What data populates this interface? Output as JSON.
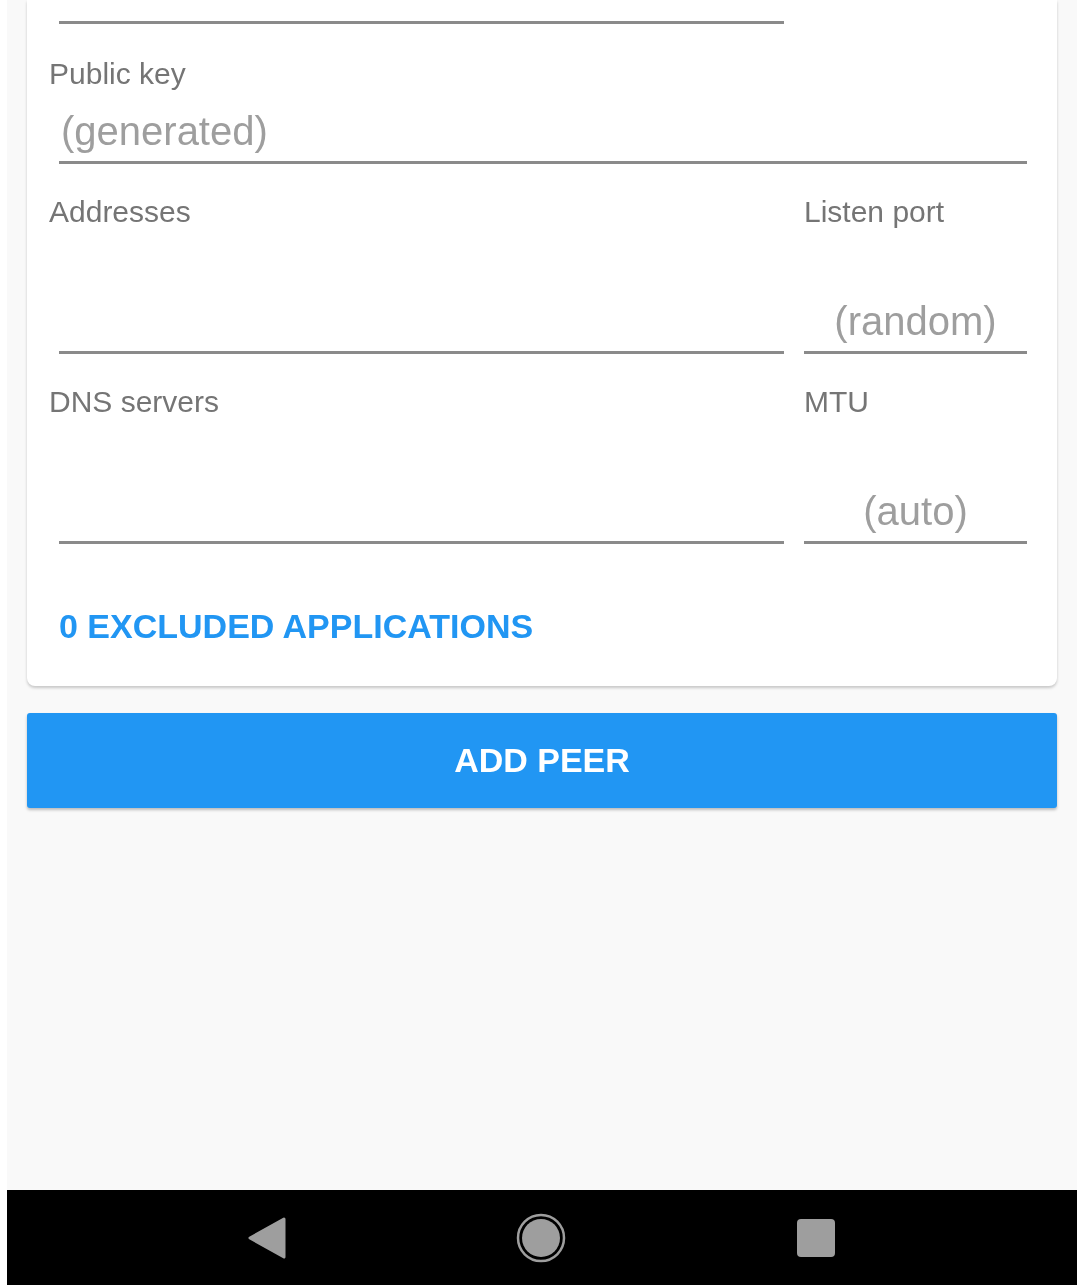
{
  "interface": {
    "public_key": {
      "label": "Public key",
      "placeholder": "(generated)"
    },
    "addresses": {
      "label": "Addresses"
    },
    "listen_port": {
      "label": "Listen port",
      "placeholder": "(random)"
    },
    "dns_servers": {
      "label": "DNS servers"
    },
    "mtu": {
      "label": "MTU",
      "placeholder": "(auto)"
    },
    "excluded_applications_button": "0 EXCLUDED APPLICATIONS"
  },
  "add_peer_button": "ADD PEER"
}
